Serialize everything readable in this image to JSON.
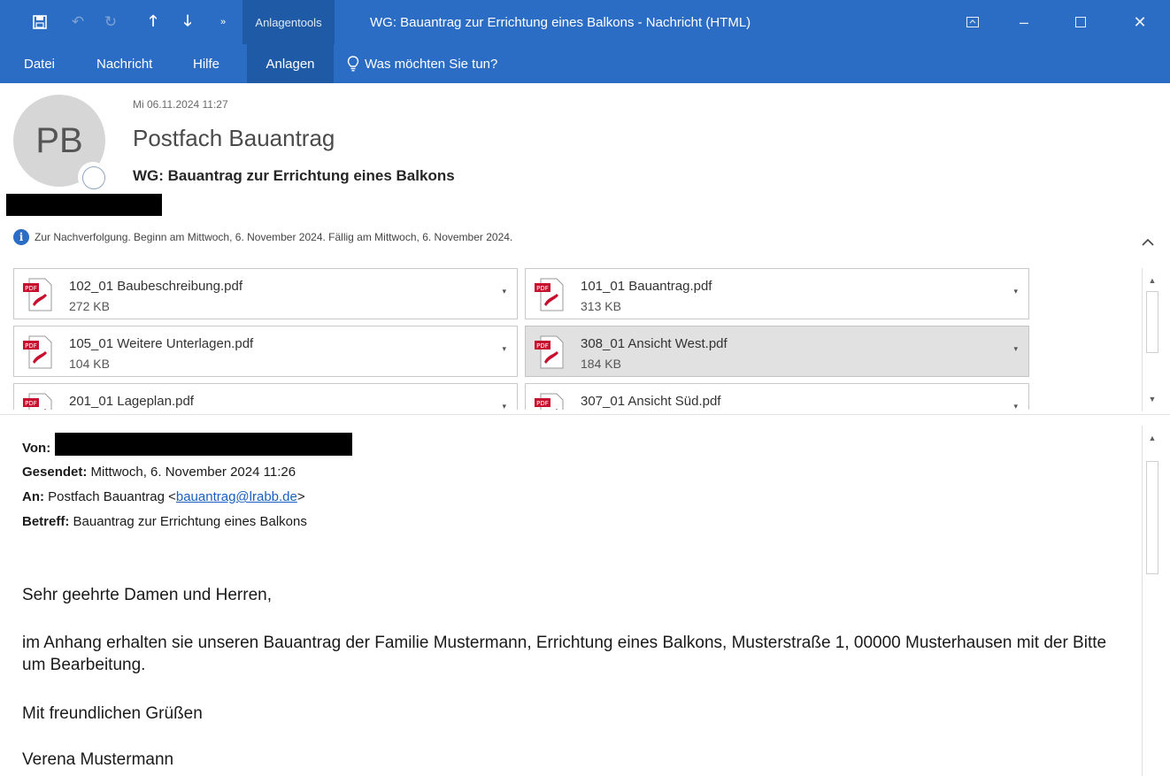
{
  "window": {
    "title": "WG: Bauantrag zur Errichtung eines Balkons  -  Nachricht (HTML)",
    "contextual_tab": "Anlagentools"
  },
  "ribbon": {
    "tabs": [
      {
        "label": "Datei"
      },
      {
        "label": "Nachricht"
      },
      {
        "label": "Hilfe"
      },
      {
        "label": "Anlagen"
      }
    ],
    "search": "Was möchten Sie tun?"
  },
  "header": {
    "initials": "PB",
    "date": "Mi 06.11.2024 11:27",
    "sender": "Postfach Bauantrag",
    "subject": "WG: Bauantrag zur Errichtung eines Balkons",
    "info": "Zur Nachverfolgung.  Beginn am Mittwoch, 6. November 2024.  Fällig am Mittwoch, 6. November 2024."
  },
  "attachments": [
    {
      "name": "102_01 Baubeschreibung.pdf",
      "size": "272 KB"
    },
    {
      "name": "101_01 Bauantrag.pdf",
      "size": "313 KB"
    },
    {
      "name": "105_01 Weitere Unterlagen.pdf",
      "size": "104 KB"
    },
    {
      "name": "308_01 Ansicht West.pdf",
      "size": "184 KB"
    },
    {
      "name": "201_01 Lageplan.pdf",
      "size": ""
    },
    {
      "name": "307_01 Ansicht Süd.pdf",
      "size": ""
    }
  ],
  "message": {
    "from_label": "Von:",
    "sent_label": "Gesendet:",
    "sent_value": "Mittwoch, 6. November 2024 11:26",
    "to_label": "An:",
    "to_name": "Postfach Bauantrag <",
    "to_email": "bauantrag@lrabb.de",
    "to_close": ">",
    "subject_label": "Betreff:",
    "subject_value": "Bauantrag zur Errichtung eines Balkons",
    "greeting": "Sehr geehrte Damen und Herren,",
    "body": "im Anhang erhalten sie unseren Bauantrag der Familie Mustermann, Errichtung eines Balkons, Musterstraße 1, 00000 Musterhausen mit der Bitte um Bearbeitung.",
    "closing": "Mit freundlichen Grüßen",
    "signature": "Verena Mustermann"
  },
  "colors": {
    "ribbon": "#2b6cc4",
    "ribbon_active": "#1f5aa6",
    "link": "#1a5fbf"
  }
}
